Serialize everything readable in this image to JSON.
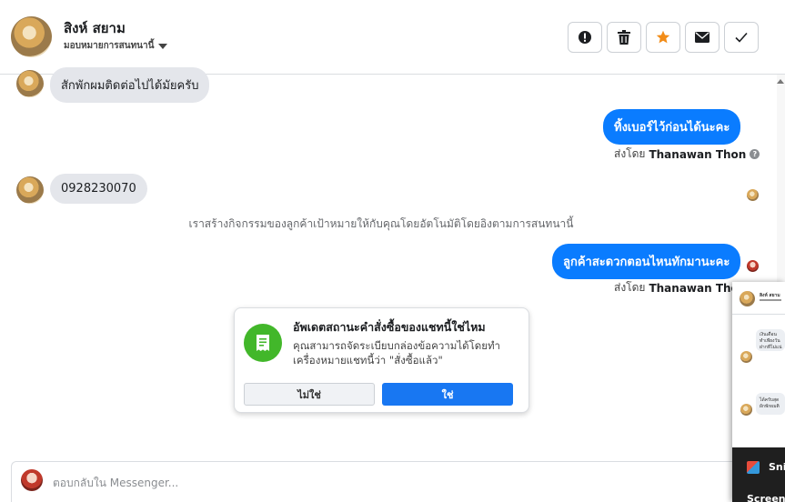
{
  "header": {
    "name": "สิงห์ สยาม",
    "assign_label": "มอบหมายการสนทนานี้"
  },
  "toolbar": {
    "icons": [
      "alert-icon",
      "trash-icon",
      "star-icon",
      "envelope-icon",
      "check-icon"
    ],
    "accent": "#f28c18"
  },
  "messages": {
    "m1": "สักพักผมติดต่อไปได้มัยครับ",
    "m2": "ทิ้งเบอร์ไว้ก่อนได้นะคะ",
    "m3": "0928230070",
    "m4": "ลูกค้าสะดวกตอนไหนทักมานะคะ"
  },
  "sent_by": {
    "prefix": "ส่งโดย",
    "agent": "Thanawan Thon",
    "help": "?"
  },
  "system_note": "เราสร้างกิจกรรมของลูกค้าเป้าหมายให้กับคุณโดยอัตโนมัติโดยอิงตามการสนทนานี้",
  "order_prompt": {
    "title": "อัพเดตสถานะคำสั่งซื้อของแชทนี้ใช่ไหม",
    "description": "คุณสามารถจัดระเบียบกล่องข้อความได้โดยทำเครื่องหมายแชทนี้ว่า \"สั่งซื้อแล้ว\"",
    "no_label": "ไม่ใช่",
    "yes_label": "ใช่",
    "icon": "receipt-icon",
    "icon_color": "#42b72a"
  },
  "reply": {
    "placeholder": "ตอบกลับใน Messenger..."
  },
  "preview": {
    "name": "สิงห์ สยาม",
    "snippet1_a": "เงินเดือน",
    "snippet1_b": "ทำเพียงวัน",
    "snippet1_c": "ฝากทีไม่แน่",
    "snippet2_a": "ได้ครับสุด",
    "snippet2_b": "ผักพักผมติ"
  },
  "taskbar": {
    "item1": "Snip",
    "item2": "Screen"
  },
  "colors": {
    "brand_blue": "#0a7cff",
    "button_blue": "#1877f2",
    "bubble_gray": "#e4e6eb"
  }
}
